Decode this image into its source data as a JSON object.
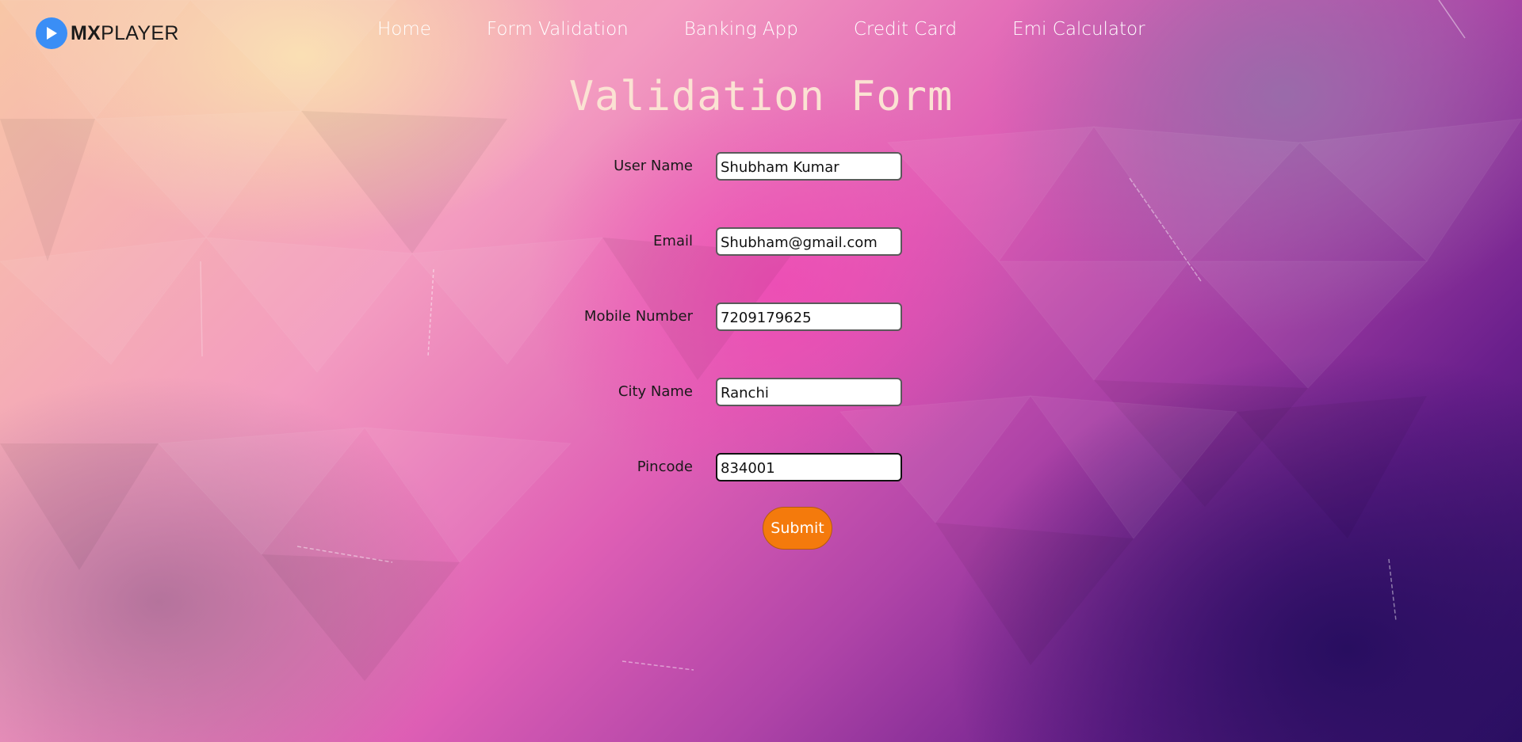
{
  "brand": {
    "logo_icon": "play-icon",
    "name_bold": "MX",
    "name_rest": "PLAYER",
    "icon_color": "#3a8ef6"
  },
  "nav": {
    "items": [
      {
        "label": "Home"
      },
      {
        "label": "Form Validation"
      },
      {
        "label": "Banking App"
      },
      {
        "label": "Credit Card"
      },
      {
        "label": "Emi Calculator"
      }
    ]
  },
  "page": {
    "title": "Validation Form"
  },
  "form": {
    "fields": [
      {
        "label": "User Name",
        "value": "Shubham Kumar"
      },
      {
        "label": "Email",
        "value": "Shubham@gmail.com"
      },
      {
        "label": "Mobile Number",
        "value": "7209179625"
      },
      {
        "label": "City Name",
        "value": "Ranchi"
      },
      {
        "label": "Pincode",
        "value": "834001"
      }
    ],
    "submit_label": "Submit",
    "submit_color": "#f47a0c"
  }
}
